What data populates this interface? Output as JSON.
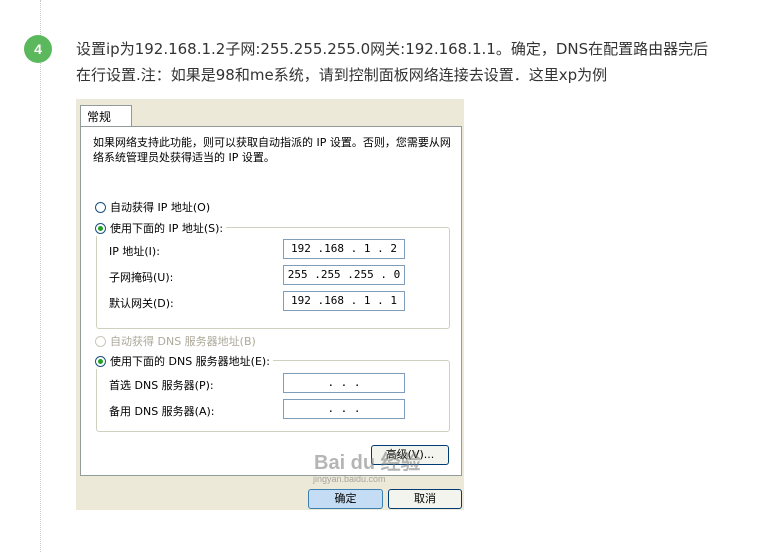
{
  "step": "4",
  "description": "设置ip为192.168.1.2子网:255.255.255.0网关:192.168.1.1。确定，DNS在配置路由器完后在行设置.注：如果是98和me系统，请到控制面板网络连接去设置．这里xp为例",
  "dialog": {
    "tab": "常规",
    "intro": "如果网络支持此功能，则可以获取自动指派的 IP 设置。否则，您需要从网络系统管理员处获得适当的 IP 设置。",
    "auto_ip": "自动获得 IP 地址(O)",
    "manual_ip": "使用下面的 IP 地址(S):",
    "ip_label": "IP 地址(I):",
    "ip_value": "192 .168 . 1 . 2",
    "mask_label": "子网掩码(U):",
    "mask_value": "255 .255 .255 . 0",
    "gw_label": "默认网关(D):",
    "gw_value": "192 .168 . 1 . 1",
    "auto_dns": "自动获得 DNS 服务器地址(B)",
    "manual_dns": "使用下面的 DNS 服务器地址(E):",
    "dns1_label": "首选 DNS 服务器(P):",
    "dns1_value": ".     .     .",
    "dns2_label": "备用 DNS 服务器(A):",
    "dns2_value": ".     .     .",
    "advanced": "高级(V)...",
    "ok": "确定",
    "cancel": "取消"
  },
  "watermark": {
    "main": "Bai du 经验",
    "sub": "jingyan.baidu.com"
  }
}
